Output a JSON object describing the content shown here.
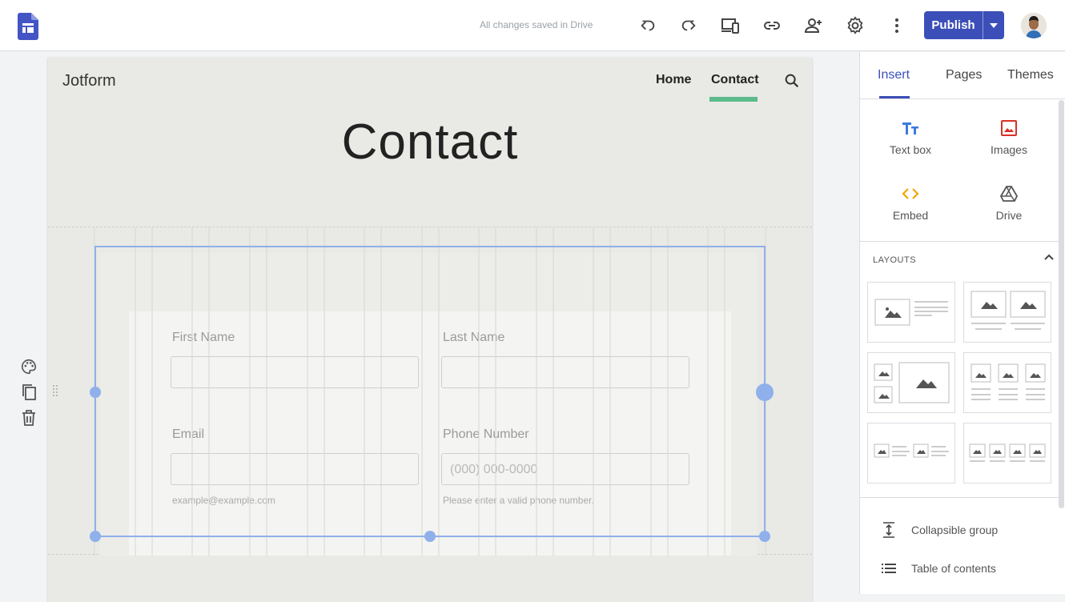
{
  "topbar": {
    "save_status": "All changes saved in Drive",
    "publish_label": "Publish"
  },
  "page": {
    "site_title": "Jotform",
    "nav": {
      "home": "Home",
      "contact": "Contact"
    },
    "hero_title": "Contact",
    "form": {
      "first_name_label": "First Name",
      "last_name_label": "Last Name",
      "email_label": "Email",
      "email_hint": "example@example.com",
      "phone_label": "Phone Number",
      "phone_placeholder": "(000) 000-0000",
      "phone_hint": "Please enter a valid phone number."
    }
  },
  "panel": {
    "tabs": {
      "insert": "Insert",
      "pages": "Pages",
      "themes": "Themes"
    },
    "insert_items": {
      "text_box": "Text box",
      "images": "Images",
      "embed": "Embed",
      "drive": "Drive"
    },
    "layouts_heading": "LAYOUTS",
    "extras": {
      "collapsible_group": "Collapsible group",
      "table_of_contents": "Table of contents"
    }
  },
  "colors": {
    "accent": "#3c4fb8",
    "nav_active": "#5bbb8a",
    "selection": "#8fb0ea"
  }
}
